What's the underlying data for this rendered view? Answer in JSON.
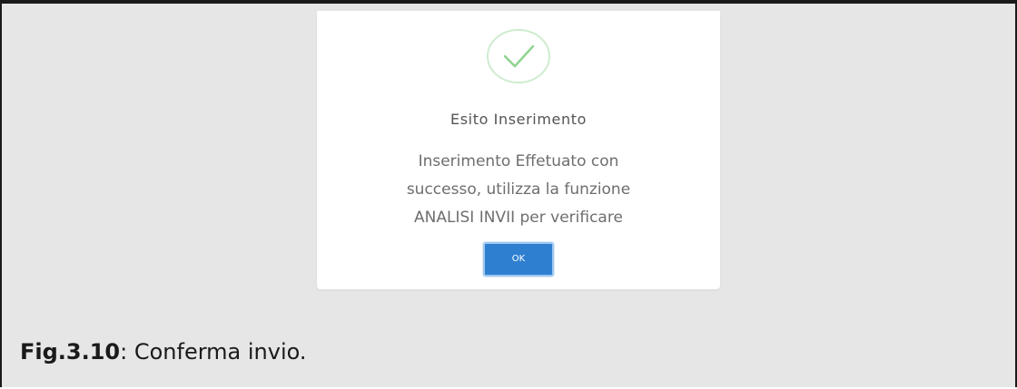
{
  "dialog": {
    "icon": "success-check-icon",
    "title": "Esito Inserimento",
    "message_lines": [
      "Inserimento Effetuato con",
      "successo, utilizza la funzione",
      "ANALISI INVII per verificare"
    ],
    "ok_label": "OK"
  },
  "caption": {
    "figure_label": "Fig.3.10",
    "separator": ":",
    "text": " Conferma invio."
  },
  "colors": {
    "background": "#e6e6e6",
    "dialog_background": "#ffffff",
    "check_green": "#8fd48f",
    "ok_button": "#2f7fd1"
  }
}
